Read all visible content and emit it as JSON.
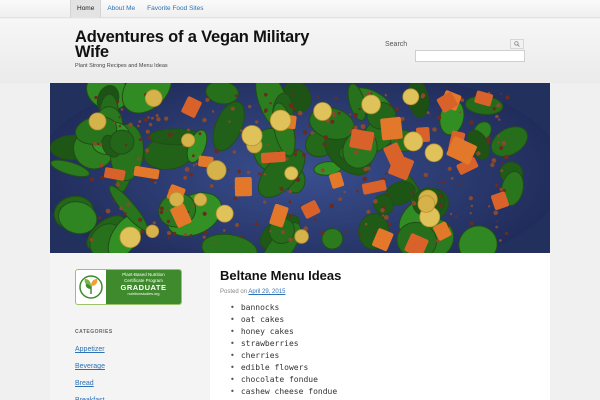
{
  "nav": {
    "items": [
      {
        "label": "Home",
        "active": true
      },
      {
        "label": "About Me",
        "active": false
      },
      {
        "label": "Favorite Food Sites",
        "active": false
      }
    ]
  },
  "header": {
    "title": "Adventures of a Vegan Military Wife",
    "tagline": "Plant Strong Recipes and Menu Ideas",
    "search_label": "Search",
    "search_icon": "search-icon",
    "search_value": ""
  },
  "sidebar": {
    "badge": {
      "line1": "Plant-Based Nutrition",
      "line1b": "Certificate Program",
      "line2": "GRADUATE",
      "line3": "nutritionstudies.org",
      "icon": "plant-icon"
    },
    "categories_heading": "CATEGORIES",
    "categories": [
      "Appetizer",
      "Beverage",
      "Bread",
      "Breakfast"
    ]
  },
  "post": {
    "title": "Beltane Menu Ideas",
    "posted_on": "Posted on",
    "date": "April 29, 2015",
    "items": [
      "bannocks",
      "oat cakes",
      "honey cakes",
      "strawberries",
      "cherries",
      "edible flowers",
      "chocolate fondue",
      "cashew cheese fondue"
    ]
  },
  "colors": {
    "link": "#2d72b5",
    "badge_green": "#3e8a2c",
    "hero_bowl": "#2b3f7a"
  }
}
